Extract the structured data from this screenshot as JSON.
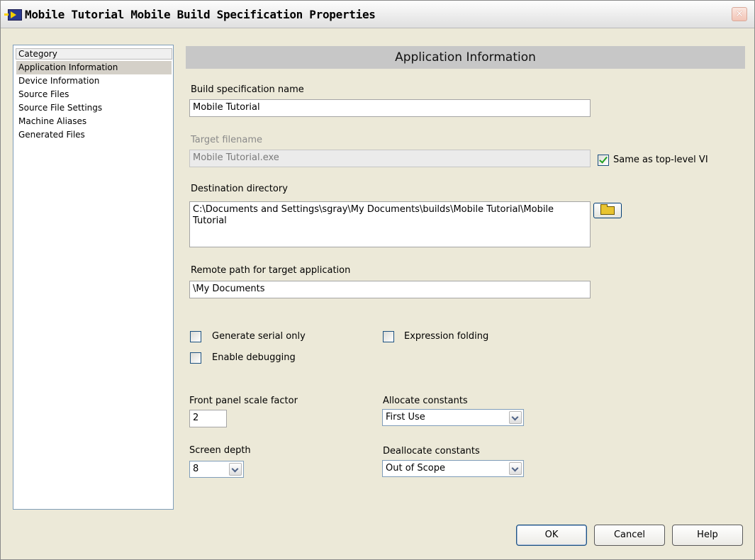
{
  "window": {
    "title": "Mobile Tutorial Mobile Build Specification Properties"
  },
  "category": {
    "header": "Category",
    "items": [
      {
        "label": "Application Information",
        "selected": true
      },
      {
        "label": "Device Information",
        "selected": false
      },
      {
        "label": "Source Files",
        "selected": false
      },
      {
        "label": "Source File Settings",
        "selected": false
      },
      {
        "label": "Machine Aliases",
        "selected": false
      },
      {
        "label": "Generated Files",
        "selected": false
      }
    ]
  },
  "section": {
    "title": "Application Information"
  },
  "form": {
    "build_name_label": "Build specification name",
    "build_name_value": "Mobile Tutorial",
    "target_filename_label": "Target filename",
    "target_filename_value": "Mobile Tutorial.exe",
    "same_as_top_level_label": "Same as top-level VI",
    "same_as_top_level_checked": true,
    "destination_label": "Destination directory",
    "destination_value": "C:\\Documents and Settings\\sgray\\My Documents\\builds\\Mobile Tutorial\\Mobile Tutorial",
    "remote_path_label": "Remote path for target application",
    "remote_path_value": "\\My Documents",
    "generate_serial_label": "Generate serial only",
    "generate_serial_checked": false,
    "expression_folding_label": "Expression folding",
    "expression_folding_checked": false,
    "enable_debugging_label": "Enable debugging",
    "enable_debugging_checked": false,
    "scale_factor_label": "Front panel scale factor",
    "scale_factor_value": "2",
    "allocate_label": "Allocate constants",
    "allocate_value": "First Use",
    "screen_depth_label": "Screen depth",
    "screen_depth_value": "8",
    "deallocate_label": "Deallocate constants",
    "deallocate_value": "Out of Scope"
  },
  "buttons": {
    "ok": "OK",
    "cancel": "Cancel",
    "help": "Help"
  },
  "icons": {
    "title_icon": "labview-run-arrow-icon",
    "close_icon": "close-x-icon",
    "browse_icon": "open-folder-icon",
    "dropdown_icon": "chevron-down-icon"
  }
}
